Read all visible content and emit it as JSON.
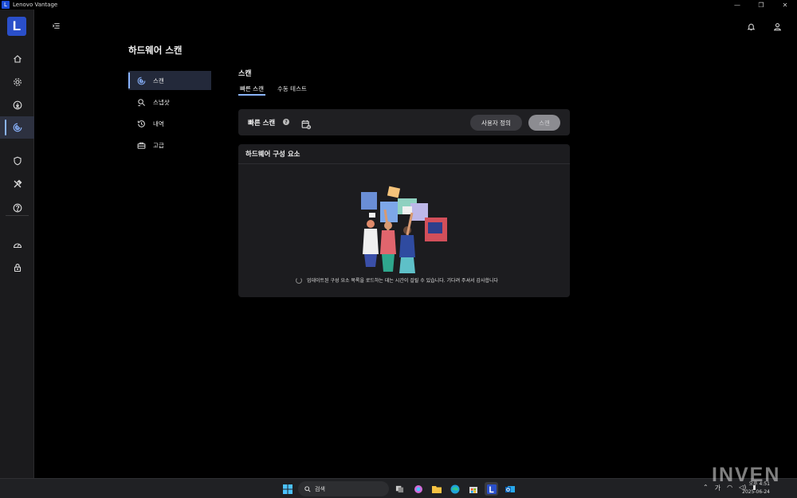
{
  "window": {
    "title": "Lenovo Vantage",
    "logo_letter": "L"
  },
  "sidebar": {
    "logo_letter": "L",
    "items": [
      {
        "icon": "home-icon"
      },
      {
        "icon": "gear-icon"
      },
      {
        "icon": "download-icon"
      },
      {
        "icon": "hardware-scan-icon",
        "active": true
      },
      {
        "icon": "shield-icon"
      },
      {
        "icon": "tools-icon"
      },
      {
        "icon": "help-icon"
      },
      {
        "icon": "speedometer-icon"
      },
      {
        "icon": "lock-icon"
      }
    ]
  },
  "header": {
    "page_title": "하드웨어 스캔"
  },
  "subnav": {
    "items": [
      {
        "label": "스캔",
        "icon": "radar-icon",
        "active": true
      },
      {
        "label": "스냅샷",
        "icon": "snapshot-icon"
      },
      {
        "label": "내역",
        "icon": "history-icon"
      },
      {
        "label": "고급",
        "icon": "toolbox-icon"
      }
    ]
  },
  "main": {
    "section_title": "스캔",
    "tabs": [
      {
        "label": "빠른 스캔",
        "active": true
      },
      {
        "label": "수동 테스트"
      }
    ],
    "quick_scan": {
      "label": "빠른 스캔",
      "help_glyph": "?",
      "custom_button": "사용자 정의",
      "scan_button": "스캔"
    },
    "hardware": {
      "title": "하드웨어 구성 요소",
      "loading_text": "업데이트된 구성 요소 목록을 로드하는 데는 시간이 걸릴 수 있습니다. 기다려 주셔서 감사합니다"
    }
  },
  "taskbar": {
    "search_placeholder": "검색",
    "time": "오후 4:51",
    "date": "2025-06-24",
    "lang": "가"
  },
  "watermark": "INVEN",
  "colors": {
    "accent": "#8ab4ff",
    "logo": "#2a4fc9",
    "card": "#1f1f22"
  }
}
